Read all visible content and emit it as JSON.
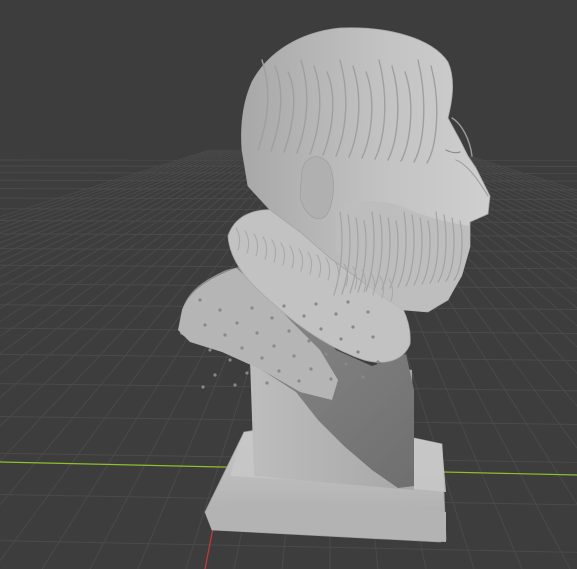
{
  "viewport": {
    "background_color": "#3d3d3d",
    "grid_line_color": "#4a4a4a",
    "x_axis_color": "#8fbf2a",
    "y_axis_color": "#c93a3a",
    "object_color": "#b9b9b9",
    "object_shadow_color": "#8c8c8c",
    "object_highlight_color": "#d4d4d4"
  },
  "scene": {
    "object_type": "sculpted-bust-mesh",
    "view": "perspective-side",
    "floor_grid": true
  }
}
